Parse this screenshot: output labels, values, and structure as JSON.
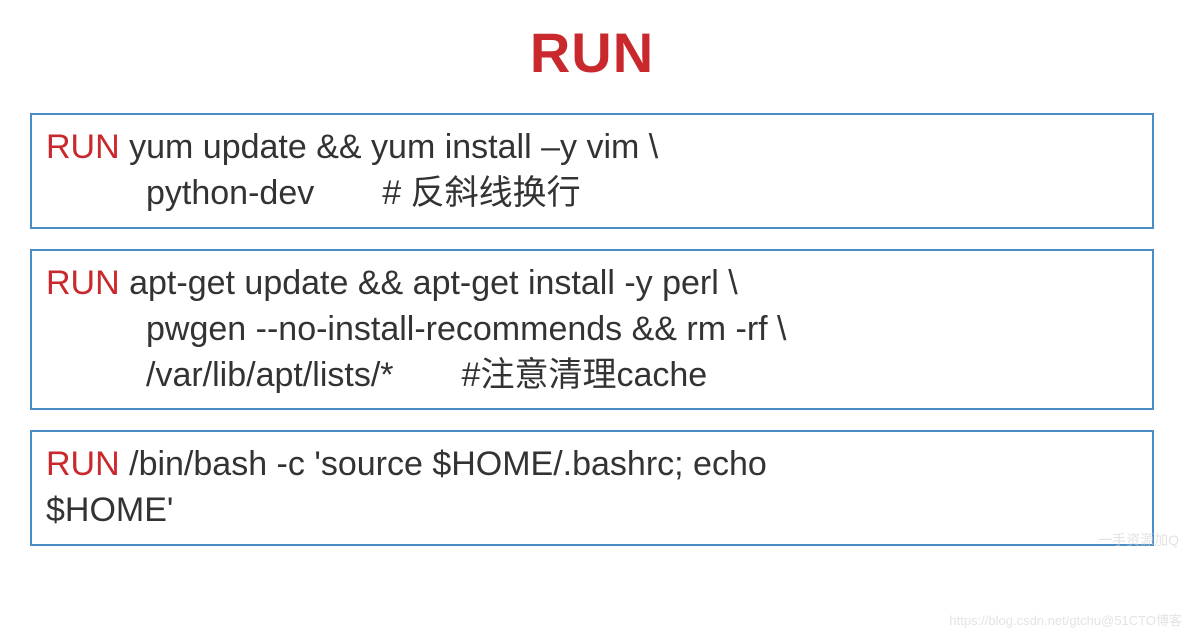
{
  "title": "RUN",
  "blocks": [
    {
      "keyword": "RUN",
      "line1": " yum update && yum install –y vim \\",
      "line2": "python-dev  # 反斜线换行"
    },
    {
      "keyword": "RUN",
      "line1": " apt-get update && apt-get install -y perl \\",
      "line2": "pwgen --no-install-recommends && rm -rf  \\",
      "line3": "/var/lib/apt/lists/*  #注意清理cache"
    },
    {
      "keyword": "RUN",
      "line1": " /bin/bash -c 'source $HOME/.bashrc; echo",
      "line4": "$HOME'"
    }
  ],
  "watermarks": {
    "w1": "一手资源加Q",
    "w2": "https://blog.csdn.net/gtchu@51CTO博客"
  }
}
